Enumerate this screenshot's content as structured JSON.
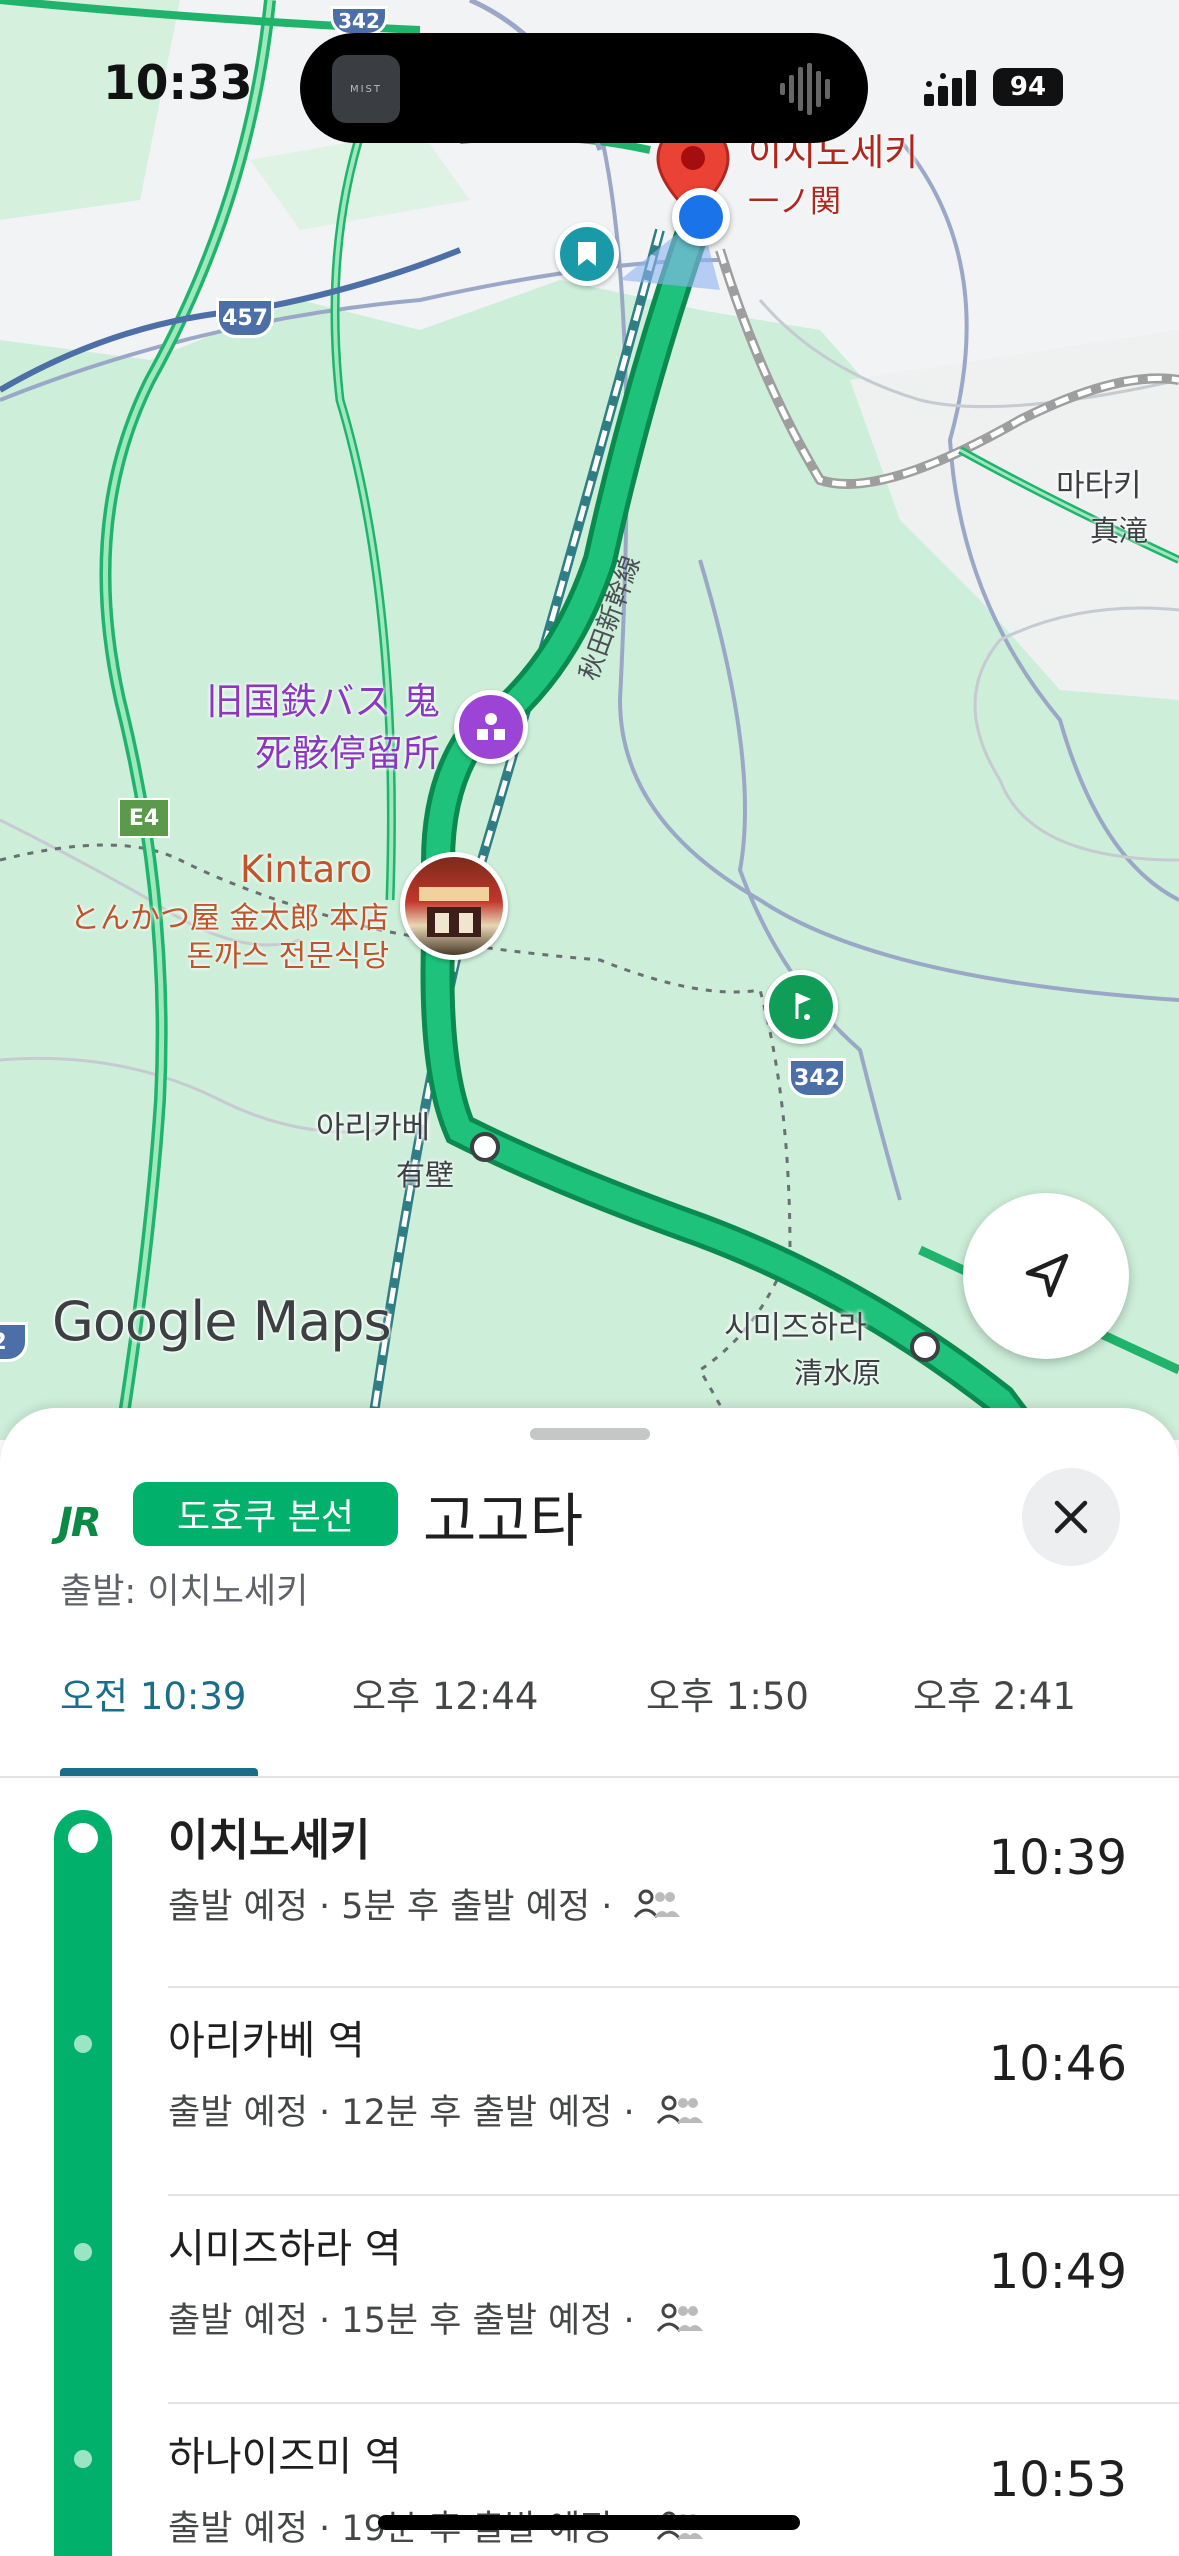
{
  "status_bar": {
    "time": "10:33",
    "battery": "94",
    "island_art_text": "MIST"
  },
  "map": {
    "labels": {
      "ichinoseki_ko": "이치노세키",
      "ichinoseki_ja": "一ノ関",
      "matagi_ko": "마타키",
      "matagi_ja": "真滝",
      "bus_stop_line1": "旧国鉄バス 鬼",
      "bus_stop_line2": "死骸停留所",
      "kintaro": "Kintaro",
      "kintaro_sub1": "とんかつ屋 金太郎 本店",
      "kintaro_sub2": "돈까스 전문식당",
      "arikabe_ko": "아리카베",
      "arikabe_ja": "有壁",
      "shimizuhara_ko": "시미즈하라",
      "shimizuhara_ja": "清水原",
      "rail_line": "秋田新幹線"
    },
    "road_shields": {
      "r342_top": "342",
      "r457": "457",
      "r342": "342",
      "e4": "E4",
      "left_edge": "2"
    },
    "logo": "Google Maps"
  },
  "sheet": {
    "operator_logo": "JR",
    "line_name": "도호쿠 본선",
    "destination": "고고타",
    "origin": "출발: 이치노세키",
    "tabs": [
      {
        "label": "오전 10:39",
        "active": true
      },
      {
        "label": "오후 12:44",
        "active": false
      },
      {
        "label": "오후 1:50",
        "active": false
      },
      {
        "label": "오후 2:41",
        "active": false
      }
    ],
    "stops": [
      {
        "name": "이치노세키",
        "status": "출발 예정 · 5분 후 출발 예정 ·",
        "time": "10:39"
      },
      {
        "name": "아리카베 역",
        "status": "출발 예정 · 12분 후 출발 예정 ·",
        "time": "10:46"
      },
      {
        "name": "시미즈하라 역",
        "status": "출발 예정 · 15분 후 출발 예정 ·",
        "time": "10:49"
      },
      {
        "name": "하나이즈미 역",
        "status": "출발 예정 · 19분 후 출발 예정 ·",
        "time": "10:53"
      }
    ]
  },
  "colors": {
    "transit_green": "#00b06b",
    "tab_accent": "#1a6e8a",
    "pin_red": "#ea4335",
    "location_blue": "#1a73e8"
  }
}
